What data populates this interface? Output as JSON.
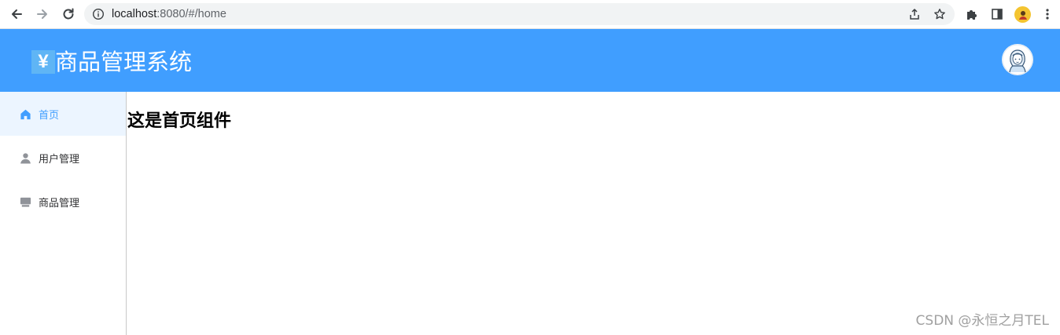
{
  "browser": {
    "url_host": "localhost",
    "url_path": ":8080/#/home"
  },
  "header": {
    "logo_glyph": "¥",
    "title": "商品管理系统",
    "accent_color": "#409eff"
  },
  "sidebar": {
    "items": [
      {
        "label": "首页",
        "icon": "home-icon",
        "active": true
      },
      {
        "label": "用户管理",
        "icon": "user-icon",
        "active": false
      },
      {
        "label": "商品管理",
        "icon": "goods-icon",
        "active": false
      }
    ],
    "active_color": "#409eff",
    "active_bg": "#ecf5ff"
  },
  "main": {
    "heading": "这是首页组件"
  },
  "watermark": "CSDN @永恒之月TEL"
}
